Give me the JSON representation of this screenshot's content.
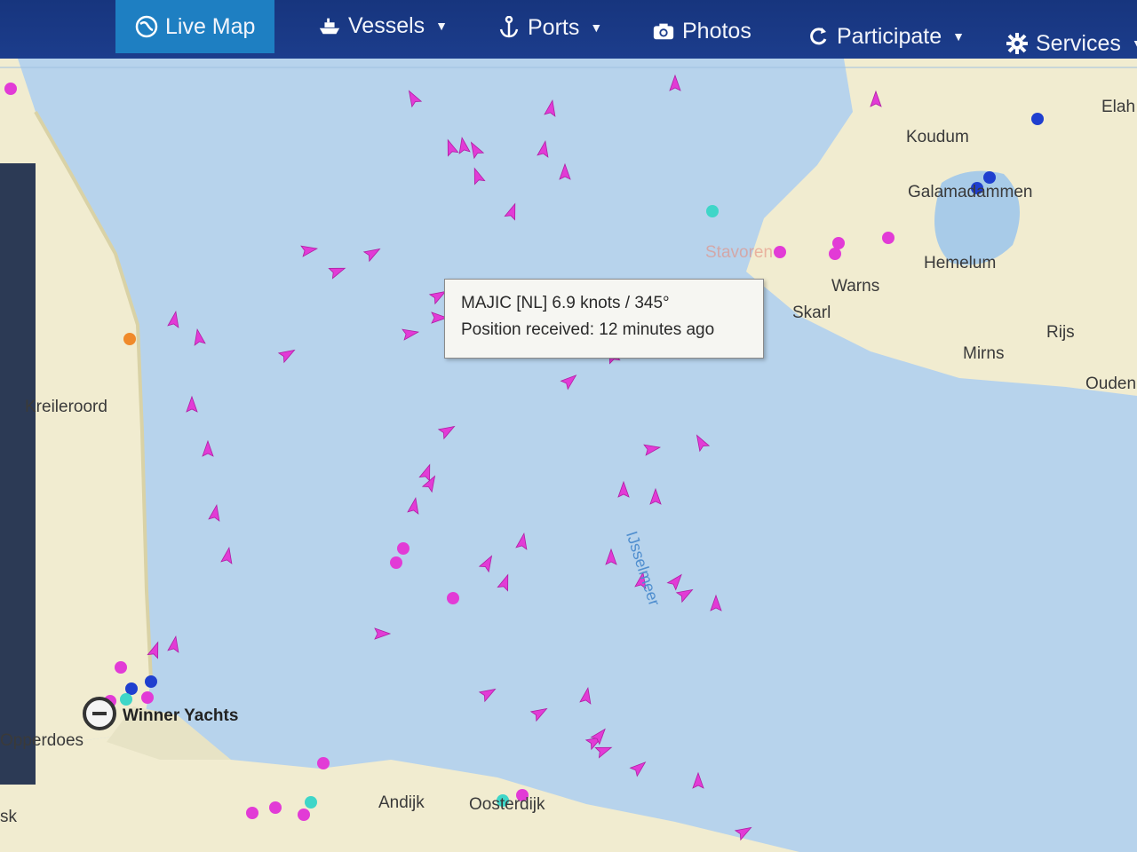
{
  "nav": {
    "items": [
      {
        "label": "Live Map",
        "icon": "globe-icon",
        "active": true
      },
      {
        "label": "Vessels",
        "icon": "ship-icon",
        "dropdown": true
      },
      {
        "label": "Ports",
        "icon": "anchor-icon",
        "dropdown": true
      },
      {
        "label": "Photos",
        "icon": "camera-icon",
        "dropdown": false
      },
      {
        "label": "Participate",
        "icon": "refresh-icon",
        "dropdown": true
      },
      {
        "label": "Services",
        "icon": "gear-icon",
        "dropdown": true
      }
    ]
  },
  "tooltip": {
    "line1": "MAJIC [NL] 6.9 knots / 345°",
    "line2": "Position received: 12 minutes ago"
  },
  "places": {
    "koudum": "Koudum",
    "galamadammen": "Galamadammen",
    "elahuizen": "Elah",
    "hemelum": "Hemelum",
    "warns": "Warns",
    "skarl": "Skarl",
    "rijs": "Rijs",
    "mirns": "Mirns",
    "oudemirdum": "Ouden",
    "kreileroord": "Kreileroord",
    "winner_yachts": "Winner Yachts",
    "opperdoes": "Opperdoes",
    "andijk": "Andijk",
    "oosterdijk": "Oosterdijk",
    "sk": "sk",
    "stavoren": "Stavoren",
    "ijsselmeer": "IJsselmeer"
  },
  "colors": {
    "water": "#b7d3ec",
    "land": "#f1ecd0",
    "vessel_pleasure": "#e23bd6",
    "vessel_blue": "#1f3fcf",
    "vessel_cyan": "#3fd6c8",
    "nav_bg": "#1c3d8c",
    "nav_active": "#1e7fc2"
  }
}
